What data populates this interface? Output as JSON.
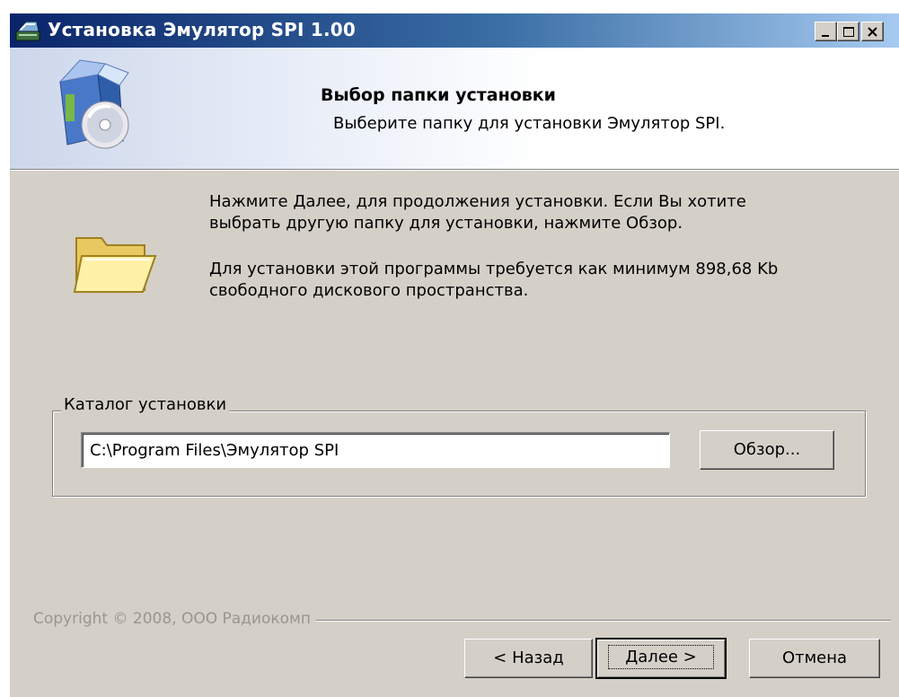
{
  "window": {
    "title": "Установка Эмулятор SPI 1.00"
  },
  "header": {
    "title": "Выбор папки установки",
    "subtitle": "Выберите папку для установки Эмулятор SPI."
  },
  "body": {
    "line1": "Нажмите Далее, для продолжения установки. Если Вы хотите",
    "line2": "выбрать другую папку для установки, нажмите Обзор.",
    "line3": "Для установки этой программы требуется как минимум 898,68 Kb",
    "line4": "свободного дискового пространства."
  },
  "install_dir": {
    "label": "Каталог установки",
    "value": "C:\\Program Files\\Эмулятор SPI",
    "browse_label": "Обзор..."
  },
  "footer": {
    "copyright": "Copyright © 2008, ООО Радиокомп",
    "back_label": "< Назад",
    "next_label": "Далее >",
    "cancel_label": "Отмена"
  },
  "icons": {
    "app": "installer-app-icon",
    "header": "setup-box-cd-icon",
    "folder": "folder-icon",
    "minimize": "minimize-icon",
    "maximize": "maximize-icon",
    "close": "close-icon"
  },
  "colors": {
    "titlebar_start": "#0a246a",
    "titlebar_end": "#a6caf0",
    "dialog_face": "#d4d0c8"
  }
}
